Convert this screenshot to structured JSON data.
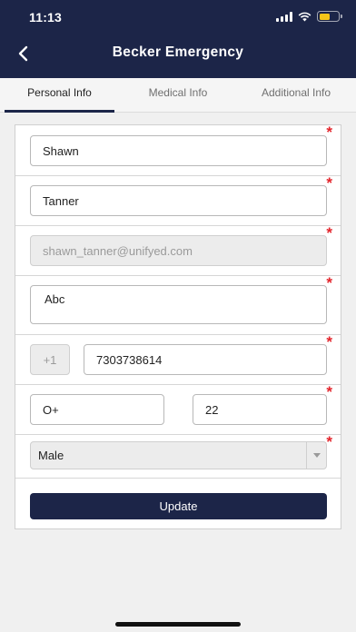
{
  "status_bar": {
    "time": "11:13"
  },
  "header": {
    "title": "Becker Emergency",
    "back_icon": "chevron-left-icon"
  },
  "tabs": [
    {
      "label": "Personal Info",
      "active": true
    },
    {
      "label": "Medical Info",
      "active": false
    },
    {
      "label": "Additional Info",
      "active": false
    }
  ],
  "form": {
    "required_marker": "*",
    "first_name": "Shawn",
    "last_name": "Tanner",
    "email": "shawn_tanner@unifyed.com",
    "address": "Abc",
    "phone_code": "+1",
    "phone": "7303738614",
    "blood_group": "O+",
    "age": "22",
    "gender": {
      "selected": "Male"
    },
    "update_label": "Update"
  },
  "colors": {
    "primary": "#1c2548",
    "required": "#e3242b",
    "battery": "#f5c518"
  }
}
